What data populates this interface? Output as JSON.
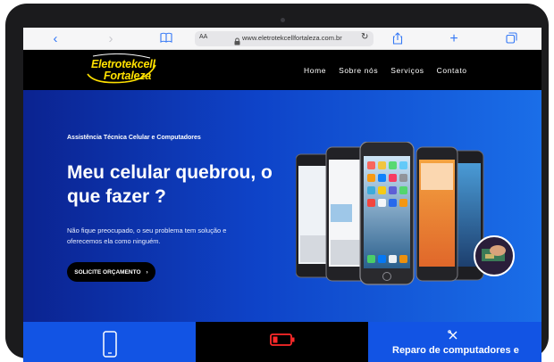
{
  "browser": {
    "text_size_label": "AA",
    "url": "www.eletrotekcellfortaleza.com.br"
  },
  "logo": {
    "line1": "Eletrotekcell",
    "line2": "Fortaleza"
  },
  "nav": {
    "items": [
      {
        "label": "Home"
      },
      {
        "label": "Sobre nós"
      },
      {
        "label": "Serviços"
      },
      {
        "label": "Contato"
      }
    ]
  },
  "hero": {
    "tagline": "Assistência Técnica Celular e Computadores",
    "title": "Meu celular  quebrou, o que fazer ?",
    "description": "Não fique preocupado, o seu problema tem solução e oferecemos ela como ninguém.",
    "cta_label": "SOLICITE ORÇAMENTO",
    "cta_arrow": "›"
  },
  "cards": [
    {
      "icon": "smartphone-icon"
    },
    {
      "icon": "battery-icon"
    },
    {
      "icon": "tools-icon",
      "title": "Reparo de computadores e"
    }
  ],
  "colors": {
    "hero_start": "#0b2390",
    "hero_end": "#1a6ee8",
    "card_blue": "#1254e4",
    "logo_yellow": "#ffe100",
    "safari_blue": "#3478f6"
  }
}
